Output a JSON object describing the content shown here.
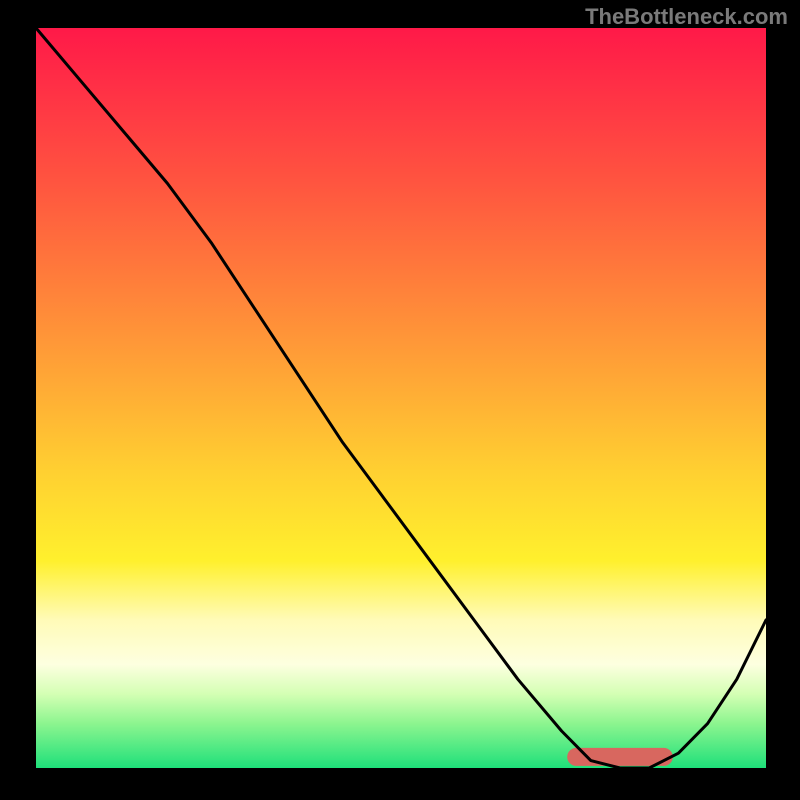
{
  "watermark": "TheBottleneck.com",
  "chart_data": {
    "type": "line",
    "title": "",
    "xlabel": "",
    "ylabel": "",
    "xlim": [
      0,
      100
    ],
    "ylim": [
      0,
      100
    ],
    "gradient_stops": [
      {
        "pct": 0,
        "color": "#ff1948"
      },
      {
        "pct": 7,
        "color": "#ff2d46"
      },
      {
        "pct": 20,
        "color": "#ff5240"
      },
      {
        "pct": 33,
        "color": "#ff7a3b"
      },
      {
        "pct": 47,
        "color": "#ffa636"
      },
      {
        "pct": 60,
        "color": "#ffd031"
      },
      {
        "pct": 72,
        "color": "#fff02d"
      },
      {
        "pct": 80,
        "color": "#fffbb8"
      },
      {
        "pct": 86,
        "color": "#fdffe0"
      },
      {
        "pct": 90,
        "color": "#d4ffb4"
      },
      {
        "pct": 94,
        "color": "#8cf58f"
      },
      {
        "pct": 100,
        "color": "#1ee07a"
      }
    ],
    "series": [
      {
        "name": "curve",
        "x": [
          0,
          6,
          12,
          18,
          24,
          30,
          36,
          42,
          48,
          54,
          60,
          66,
          72,
          76,
          80,
          84,
          88,
          92,
          96,
          100
        ],
        "y": [
          100,
          93,
          86,
          79,
          71,
          62,
          53,
          44,
          36,
          28,
          20,
          12,
          5,
          1,
          0,
          0,
          2,
          6,
          12,
          20
        ]
      }
    ],
    "target_band": {
      "x_start": 74,
      "x_end": 86,
      "y": 1.5,
      "color": "#d8675f"
    }
  }
}
